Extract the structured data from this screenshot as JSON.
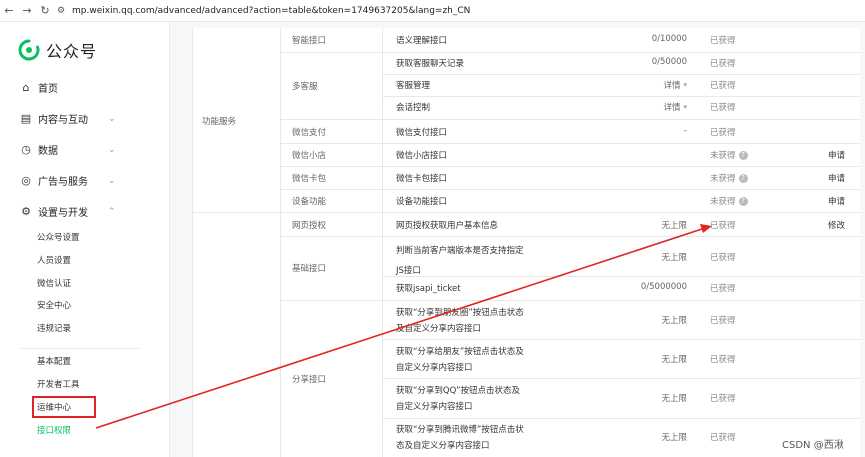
{
  "browser": {
    "url": "mp.weixin.qq.com/advanced/advanced?action=table&token=1749637205&lang=zh_CN"
  },
  "sidebar": {
    "brand": "公众号",
    "menu": [
      {
        "label": "首页",
        "icon": "home-icon"
      },
      {
        "label": "内容与互动",
        "icon": "document-icon"
      },
      {
        "label": "数据",
        "icon": "clock-icon"
      },
      {
        "label": "广告与服务",
        "icon": "compass-icon"
      },
      {
        "label": "设置与开发",
        "icon": "gear-icon"
      }
    ],
    "sub_items": [
      "公众号设置",
      "人员设置",
      "微信认证",
      "安全中心",
      "违规记录"
    ],
    "dev_items": [
      "基本配置",
      "开发者工具",
      "运维中心",
      "接口权限"
    ]
  },
  "table": {
    "group1": "功能服务",
    "group2": "",
    "rows": [
      {
        "category": "智能接口",
        "name": "语义理解接口",
        "quota": "0/10000",
        "status": "已获得",
        "action": ""
      },
      {
        "category": "多客服",
        "name": "获取客服聊天记录",
        "quota": "0/50000",
        "status": "已获得",
        "action": ""
      },
      {
        "category": "",
        "name": "客服管理",
        "quota": "详情",
        "status": "已获得",
        "action": ""
      },
      {
        "category": "",
        "name": "会话控制",
        "quota": "详情",
        "status": "已获得",
        "action": ""
      },
      {
        "category": "微信支付",
        "name": "微信支付接口",
        "quota": "-",
        "status": "已获得",
        "action": ""
      },
      {
        "category": "微信小店",
        "name": "微信小店接口",
        "quota": "",
        "status": "未获得",
        "action": "申请"
      },
      {
        "category": "微信卡包",
        "name": "微信卡包接口",
        "quota": "",
        "status": "未获得",
        "action": "申请"
      },
      {
        "category": "设备功能",
        "name": "设备功能接口",
        "quota": "",
        "status": "未获得",
        "action": "申请"
      },
      {
        "category": "网页授权",
        "name": "网页授权获取用户基本信息",
        "quota": "无上限",
        "status": "已获得",
        "action": "修改"
      },
      {
        "category": "基础接口",
        "name": "判断当前客户端版本是否支持指定JS接口",
        "quota": "无上限",
        "status": "已获得",
        "action": ""
      },
      {
        "category": "",
        "name": "获取jsapi_ticket",
        "quota": "0/5000000",
        "status": "已获得",
        "action": ""
      },
      {
        "category": "分享接口",
        "name": "获取“分享到朋友圈”按钮点击状态及自定义分享内容接口",
        "quota": "无上限",
        "status": "已获得",
        "action": ""
      },
      {
        "category": "",
        "name": "获取“分享给朋友”按钮点击状态及自定义分享内容接口",
        "quota": "无上限",
        "status": "已获得",
        "action": ""
      },
      {
        "category": "",
        "name": "获取“分享到QQ”按钮点击状态及自定义分享内容接口",
        "quota": "无上限",
        "status": "已获得",
        "action": ""
      },
      {
        "category": "",
        "name": "获取“分享到腾讯微博”按钮点击状态及自定义分享内容接口",
        "quota": "无上限",
        "status": "已获得",
        "action": ""
      }
    ]
  },
  "watermark": "CSDN @西湫",
  "colors": {
    "brand_green": "#07c160",
    "annotation_red": "#e02424"
  }
}
